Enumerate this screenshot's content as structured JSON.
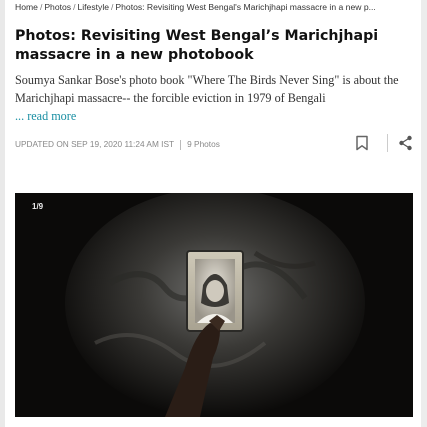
{
  "breadcrumb": {
    "items": [
      "Home",
      "Photos",
      "Lifestyle",
      "Photos: Revisiting West Bengal's Marichjhapi massacre in a new p..."
    ]
  },
  "article": {
    "headline": "Photos: Revisiting West Bengal’s Marichjhapi massacre in a new photobook",
    "summary": "Soumya Sankar Bose's photo book \"Where The Birds Never Sing\" is about the Marichjhapi massacre-- the forcible eviction in 1979 of Bengali",
    "read_more": "... read more",
    "updated": "UPDATED ON SEP 19, 2020 11:24 AM IST",
    "photo_count": "9 Photos"
  },
  "gallery": {
    "counter": "1/9"
  },
  "icons": {
    "bookmark": "bookmark-icon",
    "share": "share-icon"
  },
  "colors": {
    "link": "#1a8fa3",
    "meta_text": "#888888",
    "photo_bg": "#0b0a09"
  }
}
